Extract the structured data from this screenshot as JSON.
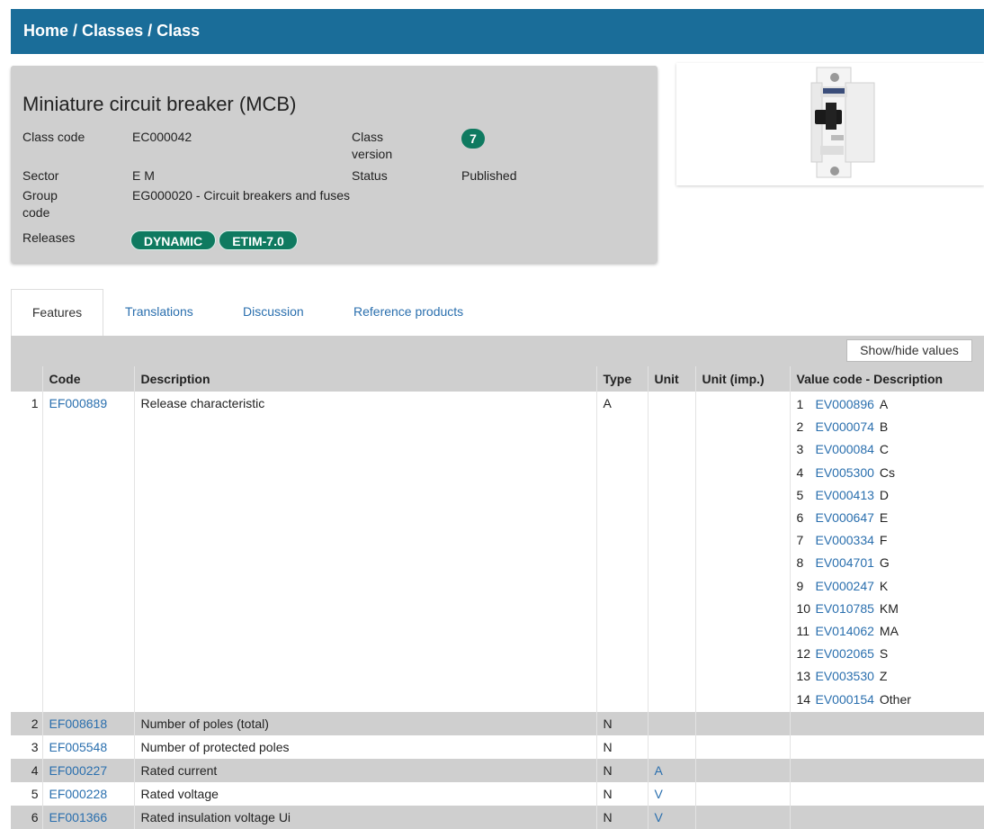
{
  "breadcrumb": {
    "home": "Home",
    "classes": "Classes",
    "current": "Class",
    "sep": " / "
  },
  "class": {
    "title": "Miniature circuit breaker (MCB)",
    "class_code_label": "Class code",
    "class_code": "EC000042",
    "class_version_label_1": "Class",
    "class_version_label_2": "version",
    "class_version": "7",
    "sector_label": "Sector",
    "sector": "E M",
    "status_label": "Status",
    "status": "Published",
    "group_label_1": "Group",
    "group_label_2": "code",
    "group": "EG000020 - Circuit breakers and fuses",
    "releases_label": "Releases",
    "releases": [
      "DYNAMIC",
      "ETIM-7.0"
    ]
  },
  "tabs": [
    "Features",
    "Translations",
    "Discussion",
    "Reference products"
  ],
  "toolbar": {
    "show_hide": "Show/hide values"
  },
  "table": {
    "headers": [
      "Code",
      "Description",
      "Type",
      "Unit",
      "Unit (imp.)",
      "Value code - Description"
    ],
    "rows": [
      {
        "n": "1",
        "code": "EF000889",
        "desc": "Release characteristic",
        "type": "A",
        "unit": "",
        "unit_imp": ""
      },
      {
        "n": "2",
        "code": "EF008618",
        "desc": "Number of poles (total)",
        "type": "N",
        "unit": "",
        "unit_imp": ""
      },
      {
        "n": "3",
        "code": "EF005548",
        "desc": "Number of protected poles",
        "type": "N",
        "unit": "",
        "unit_imp": ""
      },
      {
        "n": "4",
        "code": "EF000227",
        "desc": "Rated current",
        "type": "N",
        "unit": "A",
        "unit_imp": ""
      },
      {
        "n": "5",
        "code": "EF000228",
        "desc": "Rated voltage",
        "type": "N",
        "unit": "V",
        "unit_imp": ""
      },
      {
        "n": "6",
        "code": "EF001366",
        "desc": "Rated insulation voltage Ui",
        "type": "N",
        "unit": "V",
        "unit_imp": ""
      }
    ],
    "values": [
      {
        "n": "1",
        "code": "EV000896",
        "desc": "A"
      },
      {
        "n": "2",
        "code": "EV000074",
        "desc": "B"
      },
      {
        "n": "3",
        "code": "EV000084",
        "desc": "C"
      },
      {
        "n": "4",
        "code": "EV005300",
        "desc": "Cs"
      },
      {
        "n": "5",
        "code": "EV000413",
        "desc": "D"
      },
      {
        "n": "6",
        "code": "EV000647",
        "desc": "E"
      },
      {
        "n": "7",
        "code": "EV000334",
        "desc": "F"
      },
      {
        "n": "8",
        "code": "EV004701",
        "desc": "G"
      },
      {
        "n": "9",
        "code": "EV000247",
        "desc": "K"
      },
      {
        "n": "10",
        "code": "EV010785",
        "desc": "KM"
      },
      {
        "n": "11",
        "code": "EV014062",
        "desc": "MA"
      },
      {
        "n": "12",
        "code": "EV002065",
        "desc": "S"
      },
      {
        "n": "13",
        "code": "EV003530",
        "desc": "Z"
      },
      {
        "n": "14",
        "code": "EV000154",
        "desc": "Other"
      }
    ]
  }
}
